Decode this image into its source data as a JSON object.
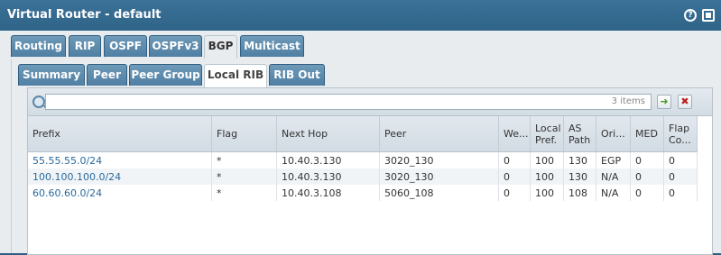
{
  "window": {
    "title": "Virtual Router - default"
  },
  "main_tabs": [
    "Routing",
    "RIP",
    "OSPF",
    "OSPFv3",
    "BGP",
    "Multicast"
  ],
  "main_tab_active": "BGP",
  "sub_tabs": [
    "Summary",
    "Peer",
    "Peer Group",
    "Local RIB",
    "RIB Out"
  ],
  "sub_tab_active": "Local RIB",
  "grid": {
    "items_label": "3 items",
    "columns": [
      "Prefix",
      "Flag",
      "Next Hop",
      "Peer",
      "We...",
      "Local Pref.",
      "AS Path",
      "Ori...",
      "MED",
      "Flap Co..."
    ],
    "rows": [
      [
        "55.55.55.0/24",
        "*",
        "10.40.3.130",
        "3020_130",
        "0",
        "100",
        "130",
        "EGP",
        "0",
        "0"
      ],
      [
        "100.100.100.0/24",
        "*",
        "10.40.3.130",
        "3020_130",
        "0",
        "100",
        "130",
        "N/A",
        "0",
        "0"
      ],
      [
        "60.60.60.0/24",
        "*",
        "10.40.3.108",
        "5060_108",
        "0",
        "100",
        "108",
        "N/A",
        "0",
        "0"
      ]
    ]
  },
  "icons": [
    "help-icon",
    "maximize-icon",
    "search-icon",
    "apply-filter-icon",
    "clear-filter-icon"
  ]
}
